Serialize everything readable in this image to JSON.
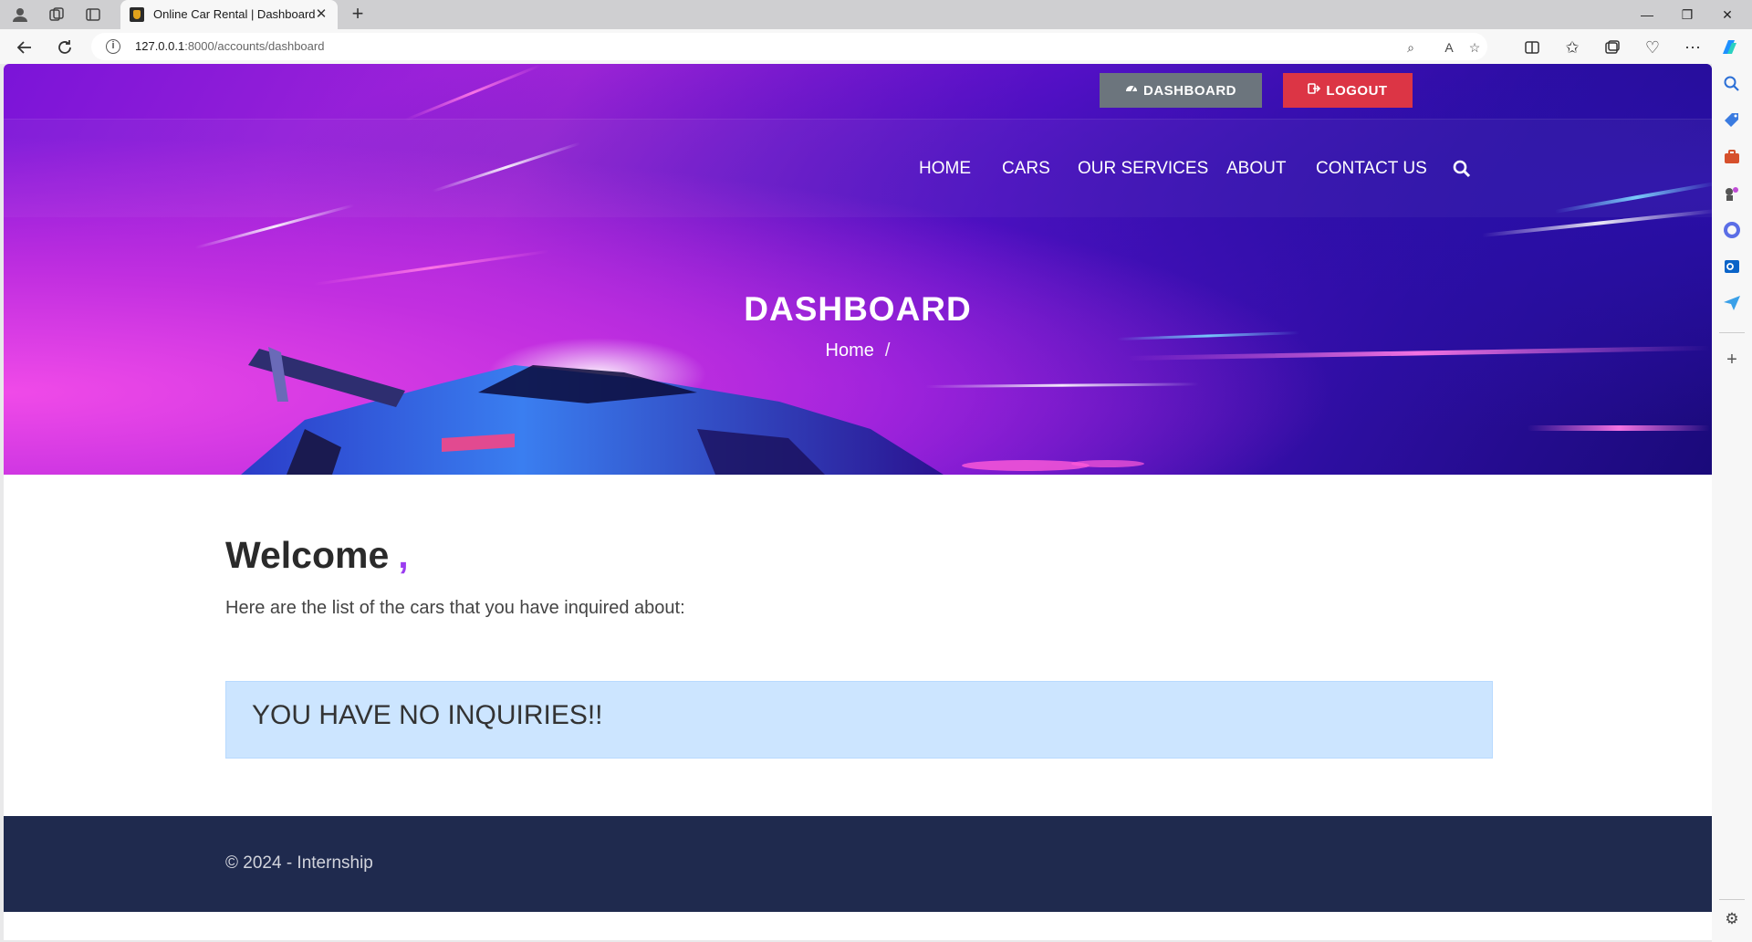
{
  "browser": {
    "tab_title": "Online Car Rental | Dashboard",
    "url_host": "127.0.0.1",
    "url_path": ":8000/accounts/dashboard"
  },
  "header": {
    "dashboard_button": "DASHBOARD",
    "logout_button": "LOGOUT"
  },
  "nav": {
    "items": [
      "HOME",
      "CARS",
      "OUR SERVICES",
      "ABOUT",
      "CONTACT US"
    ]
  },
  "hero": {
    "title": "DASHBOARD",
    "breadcrumb_home": "Home",
    "breadcrumb_sep": "/"
  },
  "content": {
    "welcome": "Welcome",
    "welcome_comma": ",",
    "lead": "Here are the list of the cars that you have inquired about:",
    "alert": "YOU HAVE NO INQUIRIES!!"
  },
  "footer": {
    "copyright": "© 2024 - Internship"
  },
  "colors": {
    "dashboard_btn": "#6c757d",
    "logout_btn": "#dc3545",
    "alert_bg": "#cce5ff",
    "footer_bg": "#1f2a4e",
    "accent": "#9b3cf0"
  }
}
